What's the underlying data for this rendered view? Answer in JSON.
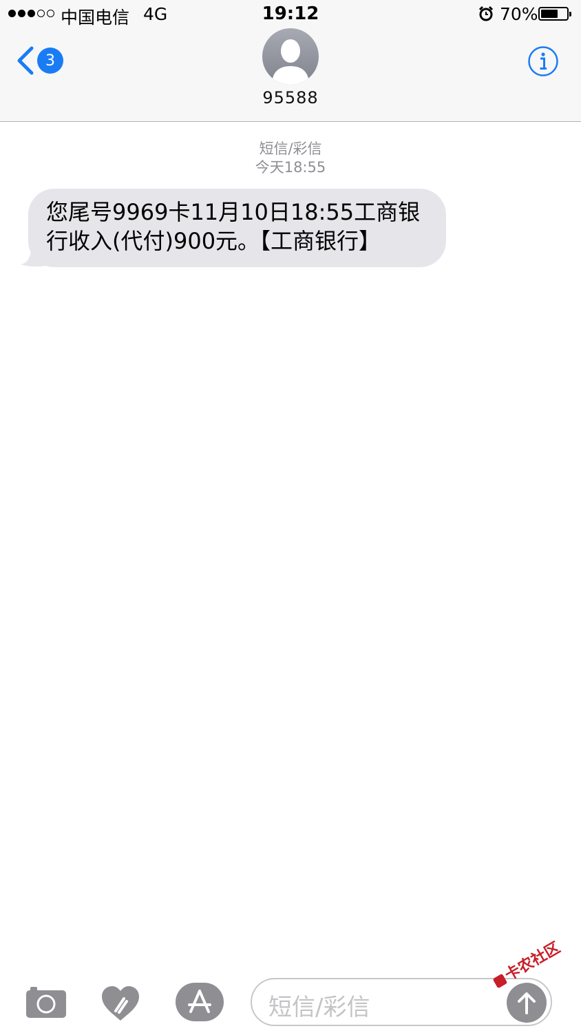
{
  "status_bar": {
    "signal": [
      "on",
      "on",
      "on",
      "off",
      "off"
    ],
    "carrier": "中国电信",
    "network": "4G",
    "time": "19:12",
    "alarm_icon": "alarm-clock-icon",
    "battery_percent": "70%",
    "battery_level": 0.7
  },
  "header": {
    "back_icon": "chevron-left-icon",
    "unread_count": "3",
    "contact_icon": "person-silhouette-icon",
    "contact_name": "95588",
    "info_icon": "info-circle-icon"
  },
  "conversation": {
    "channel": "短信/彩信",
    "timestamp": "今天18:55",
    "messages": [
      {
        "direction": "incoming",
        "text": "您尾号9969卡11月10日18:55工商银行收入(代付)900元。【工商银行】"
      }
    ]
  },
  "input_bar": {
    "camera_icon": "camera-icon",
    "digital_touch_icon": "digital-touch-heart-icon",
    "app_store_icon": "app-store-icon",
    "placeholder": "短信/彩信",
    "send_icon": "arrow-up-icon"
  },
  "watermark": {
    "text": "卡农社区"
  },
  "colors": {
    "accent": "#1a7cf5",
    "incoming_bubble": "#e5e5ea",
    "meta_text": "#8e8e93",
    "header_bg": "#f7f7f7",
    "icon_gray": "#8e8e93"
  }
}
